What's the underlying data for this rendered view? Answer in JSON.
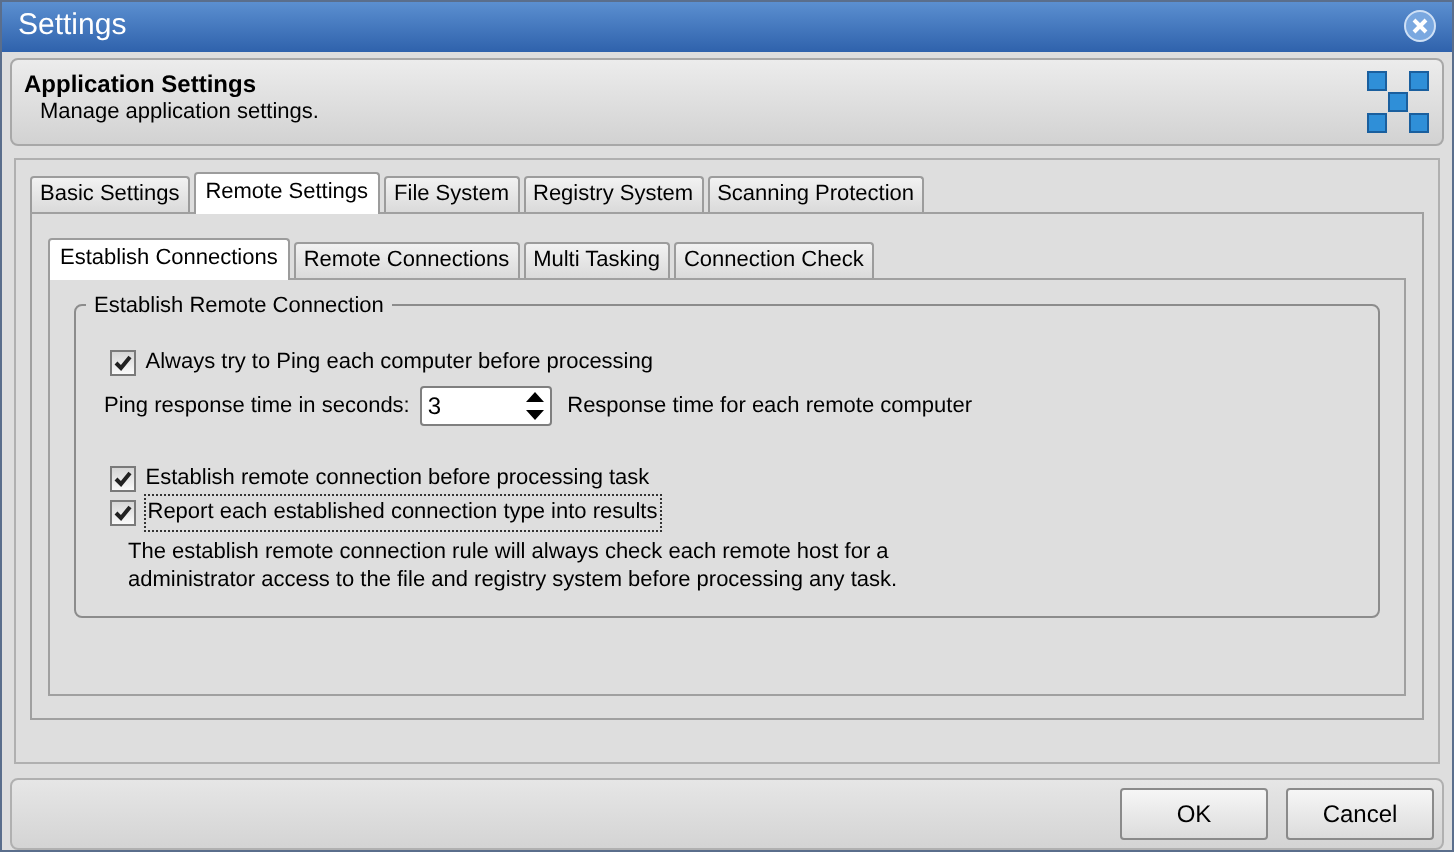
{
  "window": {
    "title": "Settings"
  },
  "header": {
    "title": "Application Settings",
    "subtitle": "Manage application settings."
  },
  "tabs": [
    {
      "label": "Basic Settings",
      "selected": false
    },
    {
      "label": "Remote Settings",
      "selected": true
    },
    {
      "label": "File System",
      "selected": false
    },
    {
      "label": "Registry System",
      "selected": false
    },
    {
      "label": "Scanning Protection",
      "selected": false
    }
  ],
  "subtabs": [
    {
      "label": "Establish Connections",
      "selected": true
    },
    {
      "label": "Remote Connections",
      "selected": false
    },
    {
      "label": "Multi Tasking",
      "selected": false
    },
    {
      "label": "Connection Check",
      "selected": false
    }
  ],
  "group": {
    "title": "Establish Remote Connection",
    "rows": [
      {
        "kind": "checkbox",
        "label": "Always try to Ping each computer before processing",
        "checked": true,
        "focused": false
      },
      {
        "kind": "spinner",
        "label": "Ping response time in seconds:",
        "value": "3",
        "hint": "Response time for each remote computer"
      },
      {
        "kind": "gap"
      },
      {
        "kind": "checkbox",
        "label": "Establish remote connection before processing task",
        "checked": true,
        "focused": false
      },
      {
        "kind": "checkbox",
        "label": "Report each established connection type into results",
        "checked": true,
        "focused": true
      },
      {
        "kind": "note",
        "text": "The establish remote connection rule will always check each remote host for a administrator access to the file and registry system before processing any task."
      }
    ]
  },
  "buttons": [
    "OK",
    "Cancel"
  ]
}
